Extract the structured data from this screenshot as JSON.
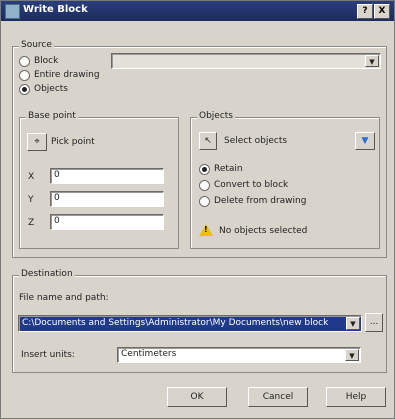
{
  "window": {
    "title": "Write Block",
    "help_glyph": "?",
    "close_glyph": "X"
  },
  "source": {
    "legend": "Source",
    "options": [
      "Block",
      "Entire drawing",
      "Objects"
    ],
    "selected": "Objects"
  },
  "base_point": {
    "legend": "Base point",
    "pick_label": "Pick point",
    "axes": [
      "X",
      "Y",
      "Z"
    ],
    "values": [
      "0",
      "0",
      "0"
    ]
  },
  "objects": {
    "legend": "Objects",
    "select_label": "Select objects",
    "options": [
      "Retain",
      "Convert to block",
      "Delete from drawing"
    ],
    "selected": "Retain",
    "status": "No objects selected"
  },
  "destination": {
    "legend": "Destination",
    "file_label": "File name and path:",
    "file_value": "C:\\Documents and Settings\\Administrator\\My Documents\\new block",
    "browse_label": "...",
    "units_label": "Insert units:",
    "units_value": "Centimeters"
  },
  "buttons": {
    "ok": "OK",
    "cancel": "Cancel",
    "help": "Help"
  },
  "colors": {
    "title_bar": "#1d2c5e",
    "dialog_bg": "#d8d4cc",
    "selection": "#1f3a8a"
  }
}
